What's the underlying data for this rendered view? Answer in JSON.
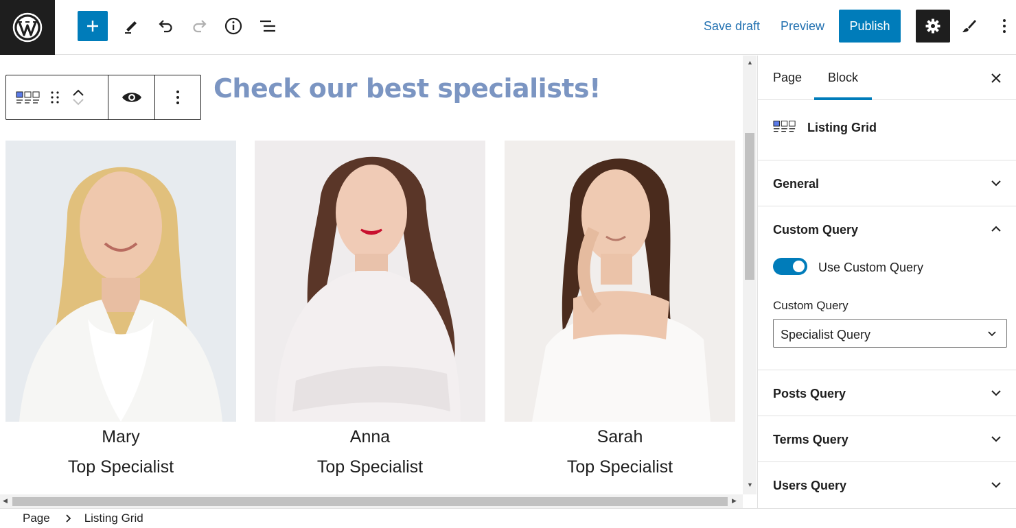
{
  "topbar": {
    "save_draft": "Save draft",
    "preview": "Preview",
    "publish": "Publish"
  },
  "canvas": {
    "heading": "Check our best specialists!",
    "cards": [
      {
        "name": "Mary",
        "role": "Top Specialist"
      },
      {
        "name": "Anna",
        "role": "Top Specialist"
      },
      {
        "name": "Sarah",
        "role": "Top Specialist"
      }
    ]
  },
  "sidebar": {
    "tabs": [
      "Page",
      "Block"
    ],
    "active_tab": "Block",
    "block_name": "Listing Grid",
    "panels": {
      "general": "General",
      "custom_query": "Custom Query",
      "posts_query": "Posts Query",
      "terms_query": "Terms Query",
      "users_query": "Users Query"
    },
    "toggle_label": "Use Custom Query",
    "toggle_on": true,
    "field_label": "Custom Query",
    "select_value": "Specialist Query"
  },
  "breadcrumb": {
    "root": "Page",
    "current": "Listing Grid"
  },
  "colors": {
    "accent": "#007cba",
    "heading": "#7b95c2",
    "dark": "#1e1e1e"
  }
}
